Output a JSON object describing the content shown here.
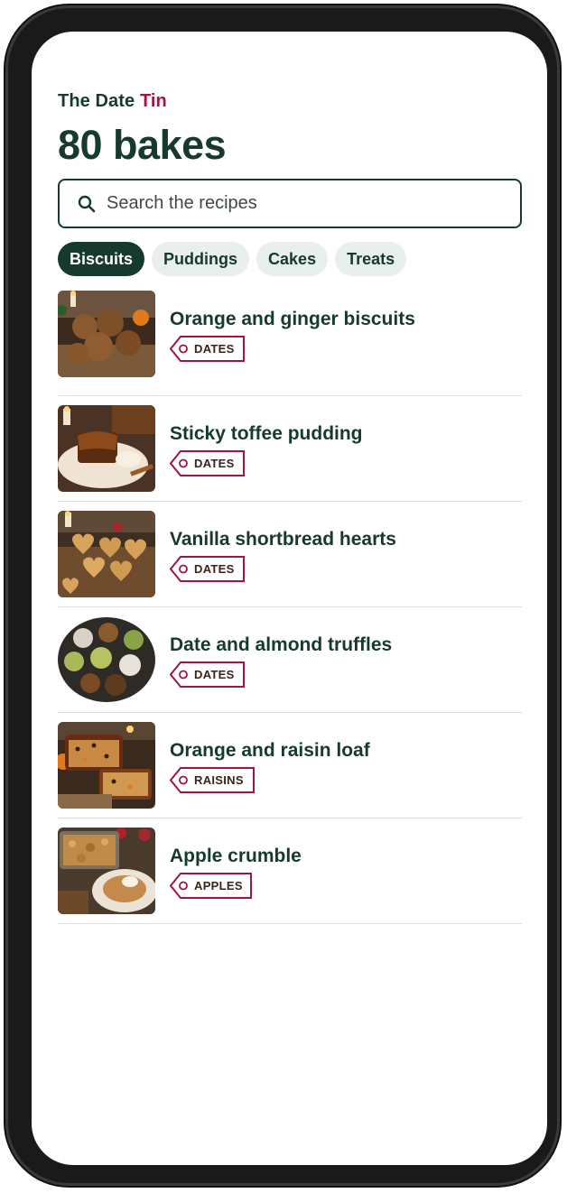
{
  "app": {
    "brand_prefix": "The Date",
    "brand_accent": "Tin",
    "title": "80 bakes"
  },
  "search": {
    "placeholder": "Search the recipes",
    "value": ""
  },
  "filters": [
    {
      "label": "Biscuits",
      "active": true
    },
    {
      "label": "Puddings",
      "active": false
    },
    {
      "label": "Cakes",
      "active": false
    },
    {
      "label": "Treats",
      "active": false
    }
  ],
  "recipes": [
    {
      "title": "Orange and ginger biscuits",
      "tag": "DATES"
    },
    {
      "title": "Sticky toffee pudding",
      "tag": "DATES"
    },
    {
      "title": "Vanilla shortbread hearts",
      "tag": "DATES"
    },
    {
      "title": "Date and almond truffles",
      "tag": "DATES"
    },
    {
      "title": "Orange and raisin loaf",
      "tag": "RAISINS"
    },
    {
      "title": "Apple crumble",
      "tag": "APPLES"
    }
  ],
  "colors": {
    "primary": "#163a2c",
    "accent": "#a0153e",
    "chip_bg": "#e9efec",
    "divider": "#dcdfdd",
    "tag_text": "#3a2318"
  },
  "icons": {
    "search": "search-icon",
    "tag": "price-tag-icon"
  }
}
